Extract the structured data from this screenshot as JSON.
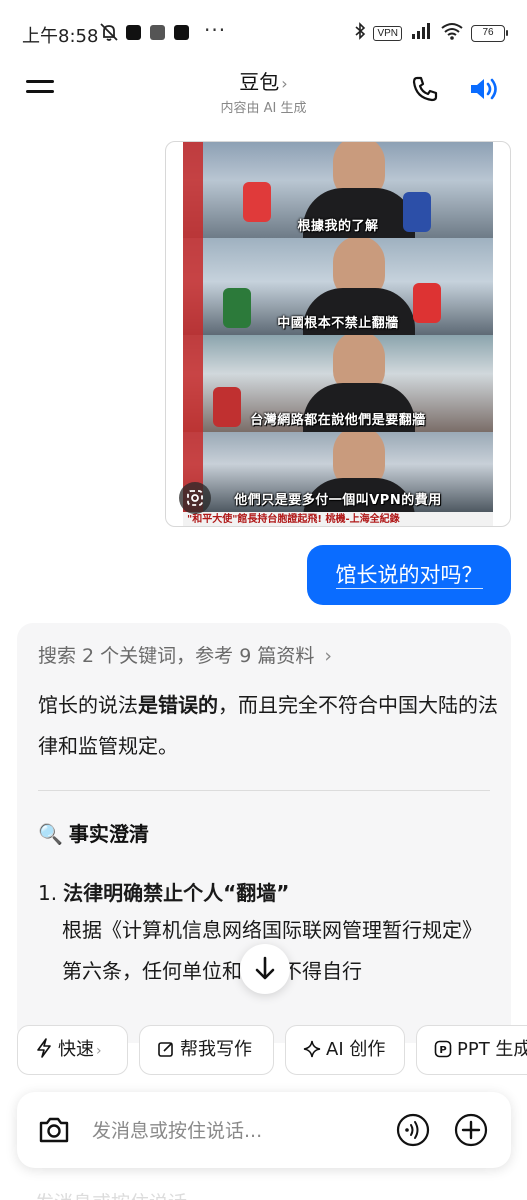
{
  "status_bar": {
    "time": "上午8:58",
    "dots": "···",
    "vpn": "VPN",
    "battery": "76"
  },
  "header": {
    "title": "豆包",
    "title_chevron": "›",
    "subtitle": "内容由 AI 生成"
  },
  "image_message": {
    "captions": [
      "根據我的了解",
      "中國根本不禁止翻牆",
      "台灣網路都在說他們是要翻牆",
      "他們只是要多付一個叫VPN的費用"
    ],
    "ticker": "\"和平大使\"館長持台胞證起飛! 桃機-上海全紀錄"
  },
  "user_message": {
    "text": "馆长说的对吗？"
  },
  "ai_message": {
    "search_summary": "搜索 2 个关键词，参考 9 篇资料",
    "search_chevron": "›",
    "answer_part1": "馆长的说法",
    "answer_bold": "是错误的",
    "answer_part2": "，而且完全不符合中国大陆的法律和监管规定。",
    "section_icon": "🔍",
    "section_title": "事实澄清",
    "item1_number": "1.",
    "item1_title": "法律明确禁止个人“翻墙”",
    "item1_body": "根据《计算机信息网络国际联网管理暂行规定》第六条，任何单位和个人不得自行"
  },
  "chips": [
    {
      "label": "快速",
      "icon": "bolt-icon",
      "chevron": "›"
    },
    {
      "label": "帮我写作",
      "icon": "edit-icon"
    },
    {
      "label": "AI 创作",
      "icon": "sparkle-icon"
    },
    {
      "label": "PPT 生成",
      "icon": "ppt-icon"
    }
  ],
  "input": {
    "placeholder": "发消息或按住说话..."
  },
  "colors": {
    "accent": "#0a6cff",
    "card_bg": "#f6f6f7"
  }
}
